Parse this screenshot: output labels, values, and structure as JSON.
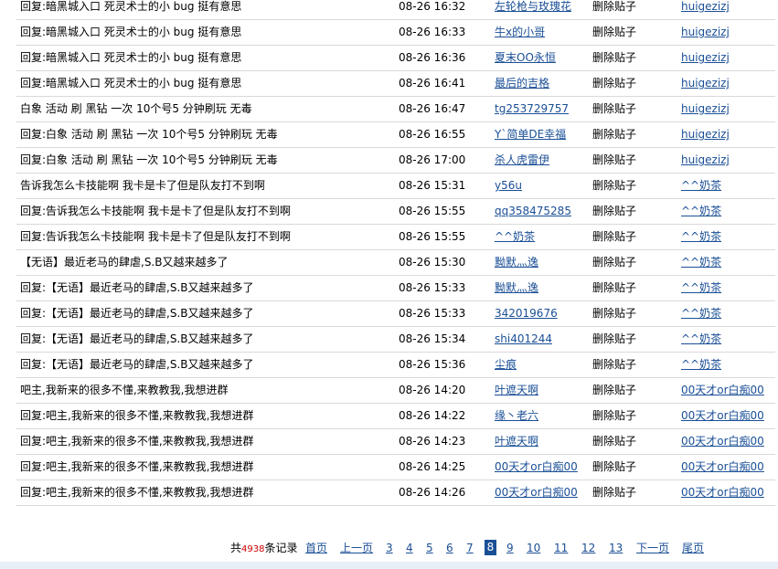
{
  "rows": [
    {
      "title": "回复:暗黑城入口 死灵术士的小 bug 挺有意思",
      "time": "08-26 16:32",
      "user": "左轮枪与玫瑰花",
      "action": "删除贴子",
      "operator": "huigezizj"
    },
    {
      "title": "回复:暗黑城入口 死灵术士的小 bug 挺有意思",
      "time": "08-26 16:33",
      "user": "牛x的小哥",
      "action": "删除贴子",
      "operator": "huigezizj"
    },
    {
      "title": "回复:暗黑城入口 死灵术士的小 bug 挺有意思",
      "time": "08-26 16:36",
      "user": "夏末OO永恒",
      "action": "删除贴子",
      "operator": "huigezizj"
    },
    {
      "title": "回复:暗黑城入口 死灵术士的小 bug 挺有意思",
      "time": "08-26 16:41",
      "user": "最后的吉格",
      "action": "删除贴子",
      "operator": "huigezizj"
    },
    {
      "title": "白象 活动 刷 黑钻 一次 10个号5 分钟刷玩 无毒",
      "time": "08-26 16:47",
      "user": "tg253729757",
      "action": "删除贴子",
      "operator": "huigezizj"
    },
    {
      "title": "回复:白象 活动 刷 黑钻 一次 10个号5 分钟刷玩 无毒",
      "time": "08-26 16:55",
      "user": "Y`简单DE幸福",
      "action": "删除贴子",
      "operator": "huigezizj"
    },
    {
      "title": "回复:白象 活动 刷 黑钻 一次 10个号5 分钟刷玩 无毒",
      "time": "08-26 17:00",
      "user": "杀人虎雷伊",
      "action": "删除贴子",
      "operator": "huigezizj"
    },
    {
      "title": "告诉我怎么卡技能啊 我卡是卡了但是队友打不到啊",
      "time": "08-26 15:31",
      "user": "y56u",
      "action": "删除贴子",
      "operator": "^^奶茶"
    },
    {
      "title": "回复:告诉我怎么卡技能啊 我卡是卡了但是队友打不到啊",
      "time": "08-26 15:55",
      "user": "qq358475285",
      "action": "删除贴子",
      "operator": "^^奶茶"
    },
    {
      "title": "回复:告诉我怎么卡技能啊 我卡是卡了但是队友打不到啊",
      "time": "08-26 15:55",
      "user": "^^奶茶",
      "action": "删除贴子",
      "operator": "^^奶茶"
    },
    {
      "title": "【无语】最近老马的肆虐,S.B又越来越多了",
      "time": "08-26 15:30",
      "user": "黝默灬逸",
      "action": "删除贴子",
      "operator": "^^奶茶"
    },
    {
      "title": "回复:【无语】最近老马的肆虐,S.B又越来越多了",
      "time": "08-26 15:33",
      "user": "黝默灬逸",
      "action": "删除贴子",
      "operator": "^^奶茶"
    },
    {
      "title": "回复:【无语】最近老马的肆虐,S.B又越来越多了",
      "time": "08-26 15:33",
      "user": "342019676",
      "action": "删除贴子",
      "operator": "^^奶茶"
    },
    {
      "title": "回复:【无语】最近老马的肆虐,S.B又越来越多了",
      "time": "08-26 15:34",
      "user": "shi401244",
      "action": "删除贴子",
      "operator": "^^奶茶"
    },
    {
      "title": "回复:【无语】最近老马的肆虐,S.B又越来越多了",
      "time": "08-26 15:36",
      "user": "尘痕",
      "action": "删除贴子",
      "operator": "^^奶茶"
    },
    {
      "title": "吧主,我新来的很多不懂,来教教我,我想进群",
      "time": "08-26 14:20",
      "user": "叶遮天啊",
      "action": "删除贴子",
      "operator": "00天才or白痴00"
    },
    {
      "title": "回复:吧主,我新来的很多不懂,来教教我,我想进群",
      "time": "08-26 14:22",
      "user": "缘丶老六",
      "action": "删除贴子",
      "operator": "00天才or白痴00"
    },
    {
      "title": "回复:吧主,我新来的很多不懂,来教教我,我想进群",
      "time": "08-26 14:23",
      "user": "叶遮天啊",
      "action": "删除贴子",
      "operator": "00天才or白痴00"
    },
    {
      "title": "回复:吧主,我新来的很多不懂,来教教我,我想进群",
      "time": "08-26 14:25",
      "user": "00天才or白痴00",
      "action": "删除贴子",
      "operator": "00天才or白痴00"
    },
    {
      "title": "回复:吧主,我新来的很多不懂,来教教我,我想进群",
      "time": "08-26 14:26",
      "user": "00天才or白痴00",
      "action": "删除贴子",
      "operator": "00天才or白痴00"
    }
  ],
  "pager": {
    "total_prefix": "共",
    "total_count": "4938",
    "total_suffix": "条记录",
    "first": "首页",
    "prev": "上一页",
    "pages": [
      "3",
      "4",
      "5",
      "6",
      "7",
      "8",
      "9",
      "10",
      "11",
      "12",
      "13"
    ],
    "current": "8",
    "next": "下一页",
    "last": "尾页"
  }
}
